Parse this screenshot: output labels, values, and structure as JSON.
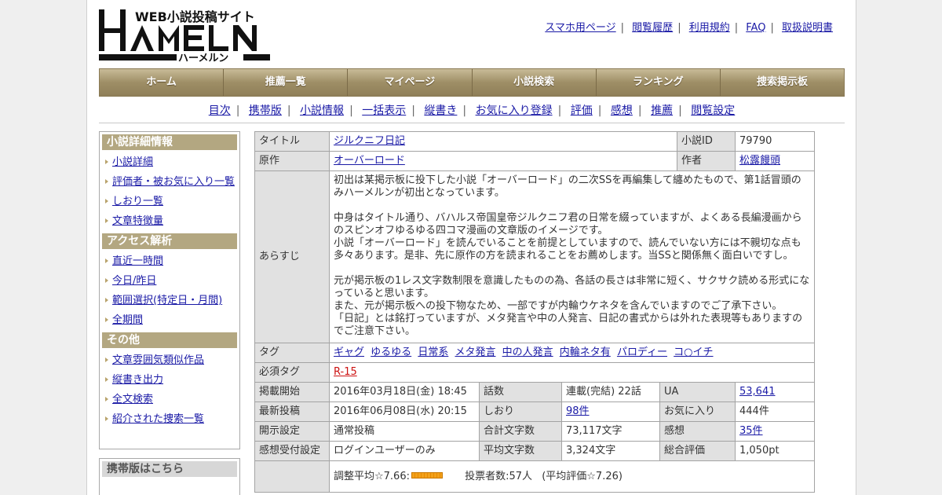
{
  "logo": {
    "tagline": "WEB小説投稿サイト",
    "name": "HAMELN",
    "kana": "ハーメルン"
  },
  "top_links": [
    "スマホ用ページ",
    "閲覧履歴",
    "利用規約",
    "FAQ",
    "取扱説明書"
  ],
  "nav": [
    "ホーム",
    "推薦一覧",
    "マイページ",
    "小説検索",
    "ランキング",
    "捜索掲示板"
  ],
  "subnav": [
    "目次",
    "携帯版",
    "小説情報",
    "一括表示",
    "縦書き",
    "お気に入り登録",
    "評価",
    "感想",
    "推薦",
    "閲覧設定"
  ],
  "sidebar": {
    "sec1": {
      "title": "小説詳細情報",
      "items": [
        "小説詳細",
        "評価者・被お気に入り一覧",
        "しおり一覧",
        "文章特徴量"
      ]
    },
    "sec2": {
      "title": "アクセス解析",
      "items": [
        "直近一時間",
        "今日/昨日",
        "範囲選択(特定日・月間)",
        "全期間"
      ]
    },
    "sec3": {
      "title": "その他",
      "items": [
        "文章雰囲気類似作品",
        "縦書き出力",
        "全文検索",
        "紹介された捜索一覧"
      ]
    },
    "mobile": {
      "title": "携帯版はこちら"
    }
  },
  "info": {
    "title_label": "タイトル",
    "title": "ジルクニフ日記",
    "id_label": "小説ID",
    "id": "79790",
    "original_label": "原作",
    "original": "オーバーロード",
    "author_label": "作者",
    "author": "松露饅頭",
    "synopsis_label": "あらすじ",
    "synopsis": [
      "初出は某掲示板に投下した小説「オーバーロード」の二次SSを再編集して纏めたもので、第1話冒頭のみハーメルンが初出となっています。",
      "中身はタイトル通り、バハルス帝国皇帝ジルクニフ君の日常を綴っていますが、よくある長編漫画からのスピンオフゆるゆる四コマ漫画の文章版のイメージです。\n小説「オーバーロード」を読んでいることを前提としていますので、読んでいない方には不親切な点も多々あります。是非、先に原作の方を読まれることをお薦めします。当SSと関係無く面白いですし。",
      "元が掲示板の1レス文字数制限を意識したものの為、各話の長さは非常に短く、サクサク読める形式になっていると思います。\nまた、元が掲示板への投下物なため、一部ですが内輪ウケネタを含んでいますのでご了承下さい。\n「日記」とは銘打っていますが、メタ発言や中の人発言、日記の書式からは外れた表現等もありますのでご注意下さい。"
    ],
    "tags_label": "タグ",
    "tags": [
      "ギャグ",
      "ゆるゆる",
      "日常系",
      "メタ発言",
      "中の人発言",
      "内輪ネタ有",
      "パロディー",
      "コ○イチ"
    ],
    "required_tags_label": "必須タグ",
    "required_tag": "R-15",
    "rows": [
      {
        "l1": "掲載開始",
        "v1": "2016年03月18日(金) 18:45",
        "l2": "話数",
        "v2": "連載(完結) 22話",
        "l3": "UA",
        "v3": "53,641",
        "v2link": false,
        "v3link": true
      },
      {
        "l1": "最新投稿",
        "v1": "2016年06月08日(水) 20:15",
        "l2": "しおり",
        "v2": "98件",
        "l3": "お気に入り",
        "v3": "444件",
        "v2link": true,
        "v3link": false
      },
      {
        "l1": "開示設定",
        "v1": "通常投稿",
        "l2": "合計文字数",
        "v2": "73,117文字",
        "l3": "感想",
        "v3": "35件",
        "v2link": false,
        "v3link": true
      },
      {
        "l1": "感想受付設定",
        "v1": "ログインユーザーのみ",
        "l2": "平均文字数",
        "v2": "3,324文字",
        "l3": "総合評価",
        "v3": "1,050pt",
        "v2link": false,
        "v3link": false
      }
    ],
    "rating": {
      "adjusted": "調整平均☆7.66:",
      "votes": "投票者数:57人",
      "average": "(平均評価☆7.26)"
    }
  }
}
